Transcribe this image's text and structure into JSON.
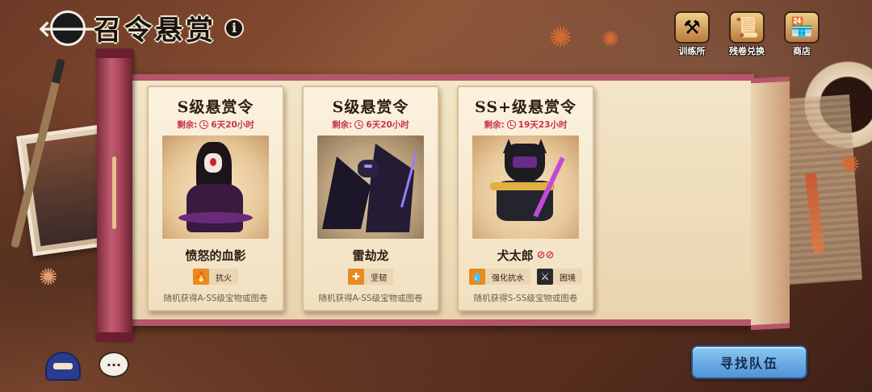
{
  "header": {
    "title": "召令悬赏",
    "info_glyph": "i",
    "back_glyph": "🡐"
  },
  "top_nav": [
    {
      "label": "训练所",
      "icon": "training-icon",
      "glyph": "⚒"
    },
    {
      "label": "残卷兑换",
      "icon": "exchange-icon",
      "glyph": "📜"
    },
    {
      "label": "商店",
      "icon": "shop-icon",
      "glyph": "🏪"
    }
  ],
  "cards": [
    {
      "title": "S级悬赏令",
      "timer_prefix": "剩余:",
      "timer": "6天20小时",
      "name": "愤怒的血影",
      "tags": [
        {
          "label": "抗火",
          "glyph": "🔥"
        }
      ],
      "reward": "随机获得A-SS级宝物或图卷"
    },
    {
      "title": "S级悬赏令",
      "timer_prefix": "剩余:",
      "timer": "6天20小时",
      "name": "雷劫龙",
      "tags": [
        {
          "label": "坚韧",
          "glyph": "✚"
        }
      ],
      "reward": "随机获得A-SS级宝物或图卷"
    },
    {
      "title": "SS+级悬赏令",
      "timer_prefix": "剩余:",
      "timer": "19天23小时",
      "name": "犬太郎",
      "tags": [
        {
          "label": "强化抗水",
          "glyph": "💧"
        },
        {
          "label": "困境",
          "glyph": "⚔"
        }
      ],
      "reward": "随机获得S-SS级宝物或图卷"
    }
  ],
  "bottom": {
    "find_team_label": "寻找队伍",
    "chat_glyph": "···"
  },
  "colors": {
    "accent_red": "#c8324a",
    "button_blue": "#4f93d8",
    "scroll_pink": "#b6566a"
  }
}
